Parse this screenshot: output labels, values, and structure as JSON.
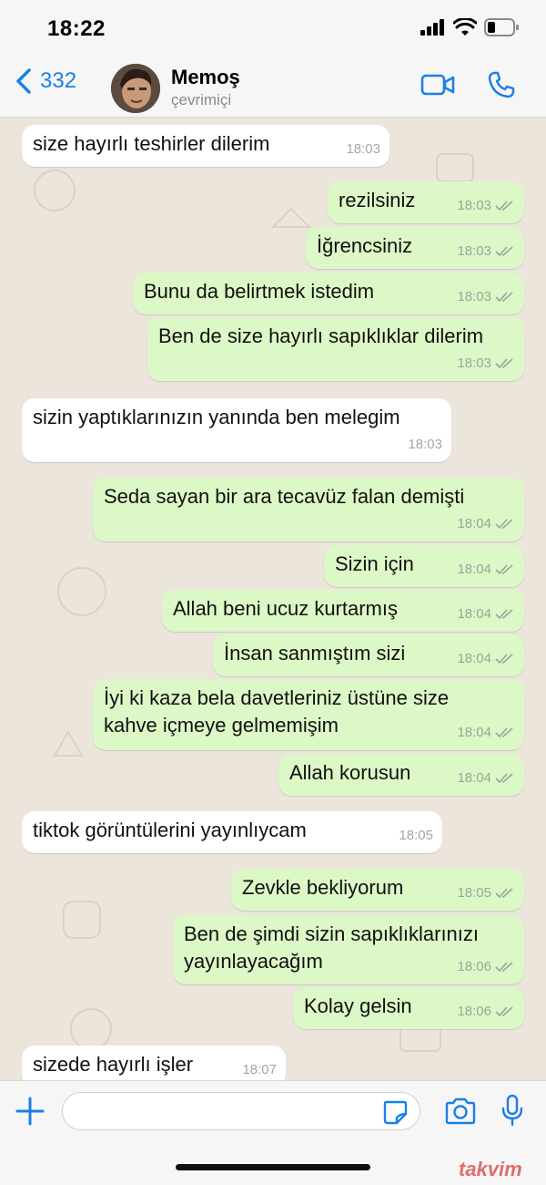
{
  "status_bar": {
    "time": "18:22"
  },
  "header": {
    "back_count": "332",
    "contact_name": "Memoş",
    "contact_status": "çevrimiçi"
  },
  "messages": [
    {
      "dir": "in",
      "text": "size hayırlı teshirler dilerim",
      "time": "18:03"
    },
    {
      "dir": "out",
      "text": "rezilsiniz",
      "time": "18:03"
    },
    {
      "dir": "out",
      "text": "İğrencsiniz",
      "time": "18:03"
    },
    {
      "dir": "out",
      "text": "Bunu da belirtmek istedim",
      "time": "18:03"
    },
    {
      "dir": "out",
      "text": "Ben de size hayırlı sapıklıklar dilerim",
      "time": "18:03"
    },
    {
      "dir": "in",
      "text": "sizin yaptıklarınızın yanında ben melegim",
      "time": "18:03"
    },
    {
      "dir": "out",
      "text": "Seda sayan bir ara tecavüz falan demişti",
      "time": "18:04"
    },
    {
      "dir": "out",
      "text": "Sizin için",
      "time": "18:04"
    },
    {
      "dir": "out",
      "text": "Allah beni ucuz kurtarmış",
      "time": "18:04"
    },
    {
      "dir": "out",
      "text": "İnsan sanmıştım sizi",
      "time": "18:04"
    },
    {
      "dir": "out",
      "text": "İyi ki kaza bela davetleriniz üstüne size\nkahve içmeye gelmemişim",
      "time": "18:04"
    },
    {
      "dir": "out",
      "text": "Allah korusun",
      "time": "18:04"
    },
    {
      "dir": "in",
      "text": "tiktok görüntülerini yayınlıycam",
      "time": "18:05"
    },
    {
      "dir": "out",
      "text": "Zevkle bekliyorum",
      "time": "18:05"
    },
    {
      "dir": "out",
      "text": "Ben de şimdi sizin sapıklıklarınızı\nyayınlayacağım",
      "time": "18:06"
    },
    {
      "dir": "out",
      "text": "Kolay gelsin",
      "time": "18:06"
    },
    {
      "dir": "in",
      "text": "sizede hayırlı işler",
      "time": "18:07"
    }
  ],
  "input": {
    "placeholder": ""
  },
  "icons": {
    "back": "chevron-left-icon",
    "video": "video-camera-icon",
    "call": "phone-icon",
    "plus": "plus-icon",
    "sticker": "sticker-icon",
    "camera": "camera-icon",
    "mic": "microphone-icon"
  },
  "colors": {
    "accent": "#1a80e6",
    "outgoing_bubble": "#dcf8c6",
    "incoming_bubble": "#ffffff"
  },
  "watermark": "takvim"
}
